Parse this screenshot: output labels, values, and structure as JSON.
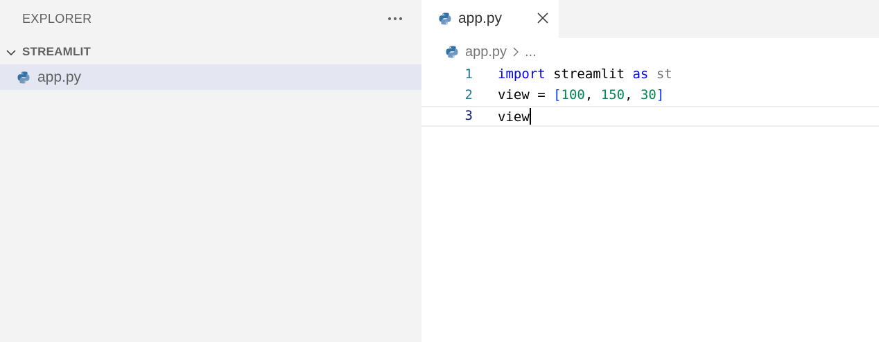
{
  "sidebar": {
    "title": "EXPLORER",
    "section_title": "STREAMLIT",
    "files": [
      {
        "name": "app.py",
        "icon": "python-file-icon"
      }
    ]
  },
  "editor": {
    "tab": {
      "label": "app.py",
      "icon": "python-file-icon"
    },
    "breadcrumb": {
      "file": "app.py",
      "more": "..."
    },
    "lines": [
      {
        "number": "1",
        "tokens": [
          "import",
          " streamlit ",
          "as",
          " st"
        ]
      },
      {
        "number": "2",
        "tokens": [
          "view = ",
          "[",
          "100",
          ", ",
          "150",
          ", ",
          "30",
          "]"
        ]
      },
      {
        "number": "3",
        "tokens": [
          "view"
        ]
      }
    ]
  },
  "colors": {
    "sidebar_bg": "#f3f3f3",
    "selected_row": "#e4e6f1",
    "keyword": "#0000ff",
    "number": "#098658",
    "bracket": "#0431fa",
    "line_number": "#237893",
    "active_line_number": "#0b216f",
    "python_blue": "#3572a5",
    "python_yellow": "#ffd43b"
  }
}
